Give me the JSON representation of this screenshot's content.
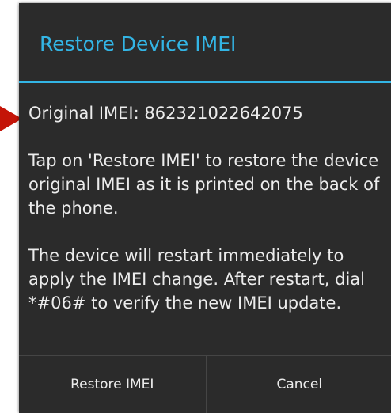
{
  "dialog": {
    "title": "Restore Device IMEI",
    "original_imei_line": "Original IMEI: 862321022642075",
    "paragraph_restore": "Tap on 'Restore IMEI' to restore the device original IMEI as it is printed on the back of the phone.",
    "paragraph_restart": "The device will restart immediately to apply the IMEI change. After restart, dial *#06# to verify the new IMEI update.",
    "buttons": {
      "restore_label": "Restore IMEI",
      "cancel_label": "Cancel"
    }
  },
  "colors": {
    "accent": "#33b5e5",
    "dialog_background": "#2b2b2b",
    "pointer_arrow": "#c41408"
  },
  "icons": {
    "pointer": "red-arrow-pointer-icon"
  }
}
